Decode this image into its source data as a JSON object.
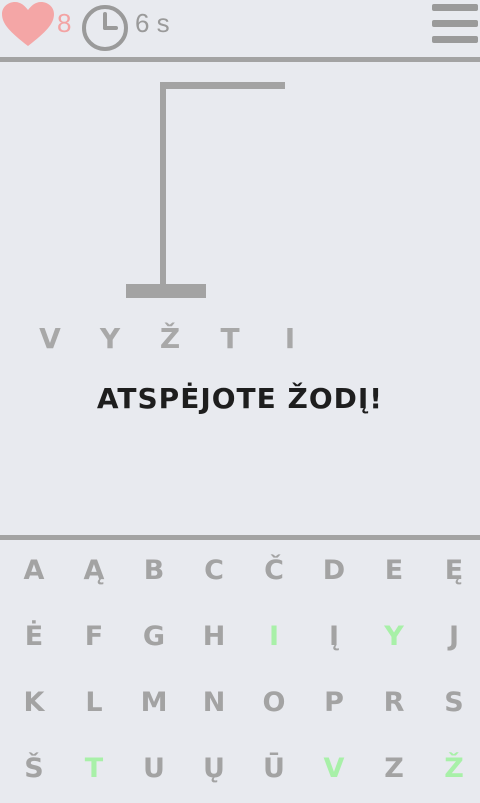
{
  "header": {
    "heart_icon": "heart-icon",
    "lives": "8",
    "clock_icon": "clock-icon",
    "timer": "6 s",
    "menu_icon": "hamburger-menu-icon"
  },
  "game": {
    "word_letters": [
      "V",
      "Y",
      "Ž",
      "T",
      "I"
    ],
    "message": "ATSPĖJOTE ŽODĮ!"
  },
  "keyboard": {
    "keys": [
      {
        "label": "A",
        "state": "available"
      },
      {
        "label": "Ą",
        "state": "available"
      },
      {
        "label": "B",
        "state": "available"
      },
      {
        "label": "C",
        "state": "available"
      },
      {
        "label": "Č",
        "state": "available"
      },
      {
        "label": "D",
        "state": "available"
      },
      {
        "label": "E",
        "state": "available"
      },
      {
        "label": "Ę",
        "state": "available"
      },
      {
        "label": "Ė",
        "state": "available"
      },
      {
        "label": "F",
        "state": "available"
      },
      {
        "label": "G",
        "state": "available"
      },
      {
        "label": "H",
        "state": "available"
      },
      {
        "label": "I",
        "state": "correct"
      },
      {
        "label": "Į",
        "state": "available"
      },
      {
        "label": "Y",
        "state": "correct"
      },
      {
        "label": "J",
        "state": "available"
      },
      {
        "label": "K",
        "state": "available"
      },
      {
        "label": "L",
        "state": "available"
      },
      {
        "label": "M",
        "state": "available"
      },
      {
        "label": "N",
        "state": "available"
      },
      {
        "label": "O",
        "state": "available"
      },
      {
        "label": "P",
        "state": "available"
      },
      {
        "label": "R",
        "state": "available"
      },
      {
        "label": "S",
        "state": "available"
      },
      {
        "label": "Š",
        "state": "available"
      },
      {
        "label": "T",
        "state": "correct"
      },
      {
        "label": "U",
        "state": "available"
      },
      {
        "label": "Ų",
        "state": "available"
      },
      {
        "label": "Ū",
        "state": "available"
      },
      {
        "label": "V",
        "state": "correct"
      },
      {
        "label": "Z",
        "state": "available"
      },
      {
        "label": "Ž",
        "state": "correct"
      }
    ]
  },
  "colors": {
    "background": "#e8eaef",
    "key_gray": "#a3a3a3",
    "key_correct": "#a8f0a8",
    "lives": "#f3a3a3",
    "heart": "#f4a6a6",
    "message": "#1e1e1e"
  }
}
